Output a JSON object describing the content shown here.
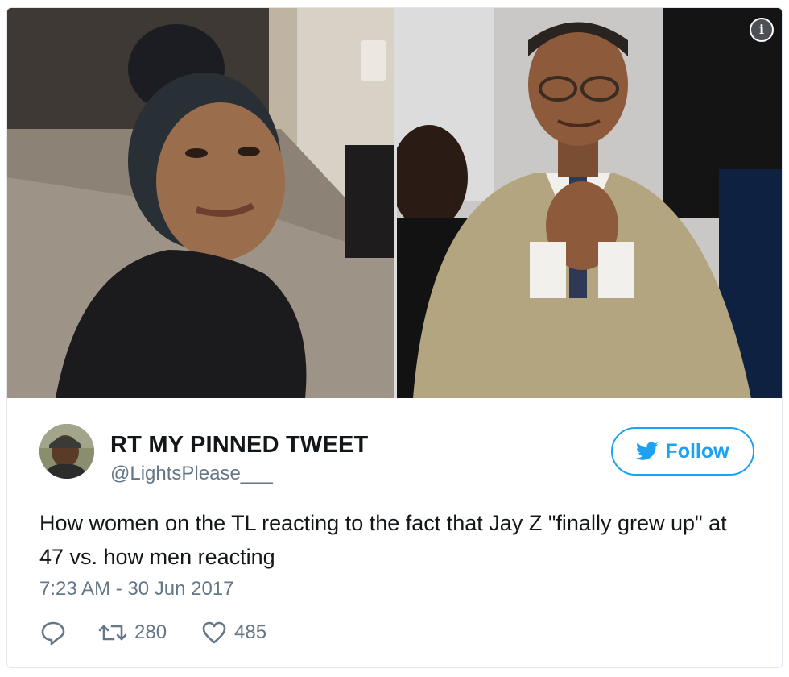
{
  "tweet": {
    "author": {
      "display_name": "RT MY PINNED TWEET",
      "handle": "@LightsPlease___"
    },
    "follow_label": "Follow",
    "text": "How women on the TL reacting to the fact that Jay Z \"finally grew up\" at 47 vs. how men reacting",
    "timestamp": "7:23 AM - 30 Jun 2017",
    "retweets": "280",
    "likes": "485"
  },
  "icons": {
    "info": "info-icon",
    "follow": "twitter-bird-icon",
    "reply": "reply-icon",
    "retweet": "retweet-icon",
    "like": "heart-icon"
  },
  "colors": {
    "accent": "#1da1f2",
    "muted": "#657786",
    "text": "#14171a",
    "border": "#e1e8ed"
  },
  "media": {
    "left_photo": "Woman making a skeptical face",
    "right_photo": "Smiling man in a tan suit with clasped hands"
  }
}
